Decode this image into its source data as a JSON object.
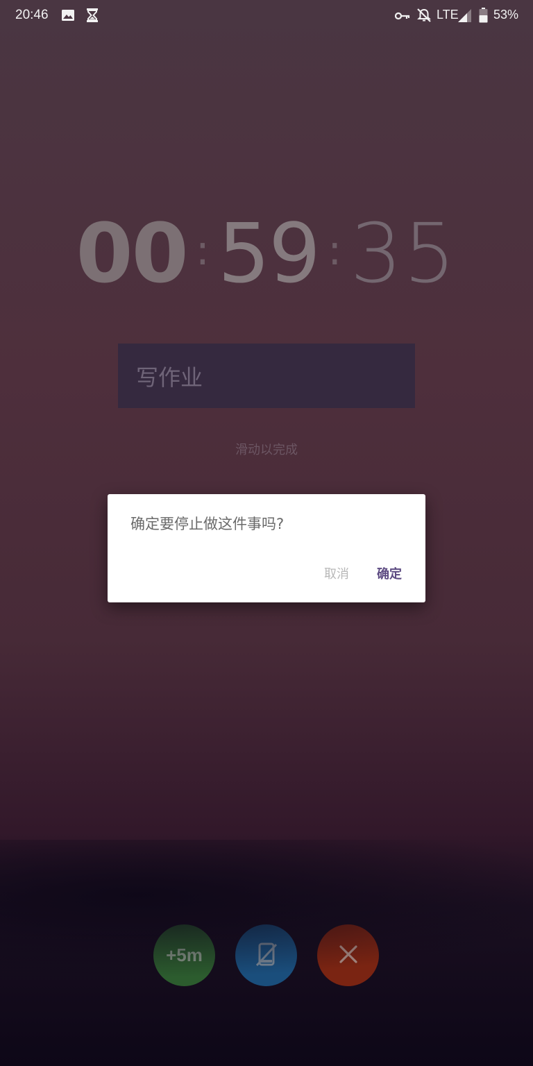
{
  "status_bar": {
    "time": "20:46",
    "network": "LTE",
    "battery": "53%",
    "left_icons": [
      "image-icon",
      "hourglass-icon"
    ],
    "right_icons": [
      "vpn-key-icon",
      "notifications-off-icon",
      "signal-icon",
      "battery-icon"
    ]
  },
  "timer": {
    "hours": "00",
    "minutes": "59",
    "seconds": "35",
    "separator": ":"
  },
  "task": {
    "name": "写作业"
  },
  "hint": "滑动以完成",
  "dialog": {
    "message": "确定要停止做这件事吗?",
    "cancel_label": "取消",
    "confirm_label": "确定",
    "confirm_color": "#5d4b82"
  },
  "actions": {
    "add_time_label": "+5m",
    "add_time_color": "#2c5c2e",
    "phone_lock_icon": "phone-lock-icon",
    "phone_lock_color": "#1a4e7c",
    "stop_icon": "close-icon",
    "stop_color": "#7a2412"
  }
}
